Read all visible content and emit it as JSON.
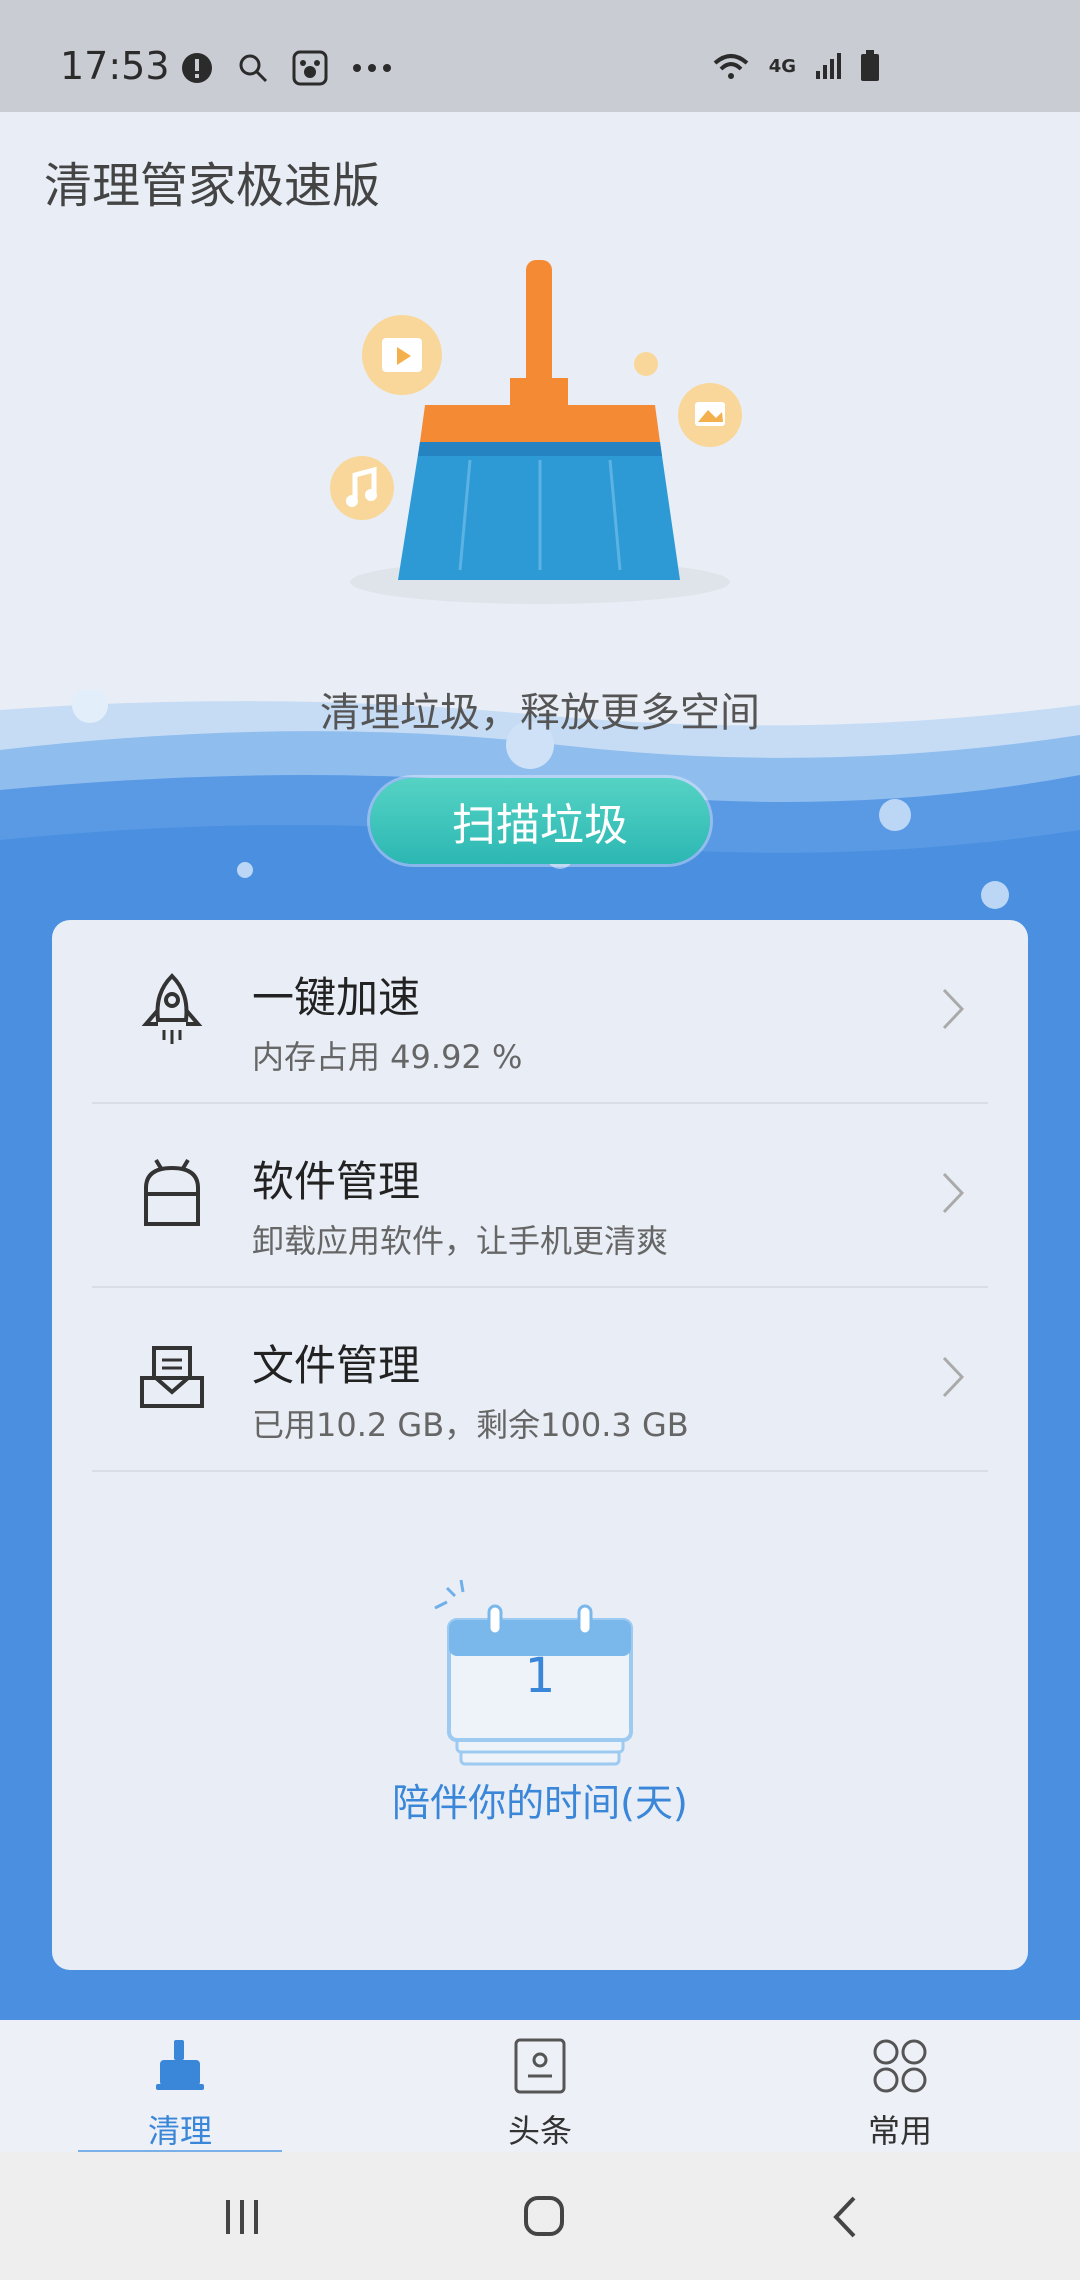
{
  "status_bar": {
    "time": "17:53",
    "network": "4G"
  },
  "app": {
    "title": "清理管家极速版"
  },
  "hero": {
    "tagline": "清理垃圾，释放更多空间",
    "scan_button": "扫描垃圾"
  },
  "menu": [
    {
      "title": "一键加速",
      "subtitle": "内存占用 49.92 %",
      "icon": "rocket-icon"
    },
    {
      "title": "软件管理",
      "subtitle": "卸载应用软件，让手机更清爽",
      "icon": "android-icon"
    },
    {
      "title": "文件管理",
      "subtitle": "已用10.2 GB，剩余100.3 GB",
      "icon": "inbox-icon"
    }
  ],
  "companion": {
    "days": "1",
    "label": "陪伴你的时间(天)"
  },
  "tabs": [
    {
      "label": "清理",
      "active": true
    },
    {
      "label": "头条",
      "active": false
    },
    {
      "label": "常用",
      "active": false
    }
  ],
  "colors": {
    "accent": "#3a86d8",
    "button": "#2cb7b3",
    "broom_head": "#2d9ad6",
    "broom_handle": "#f58a35",
    "badge": "#f9d79a"
  }
}
